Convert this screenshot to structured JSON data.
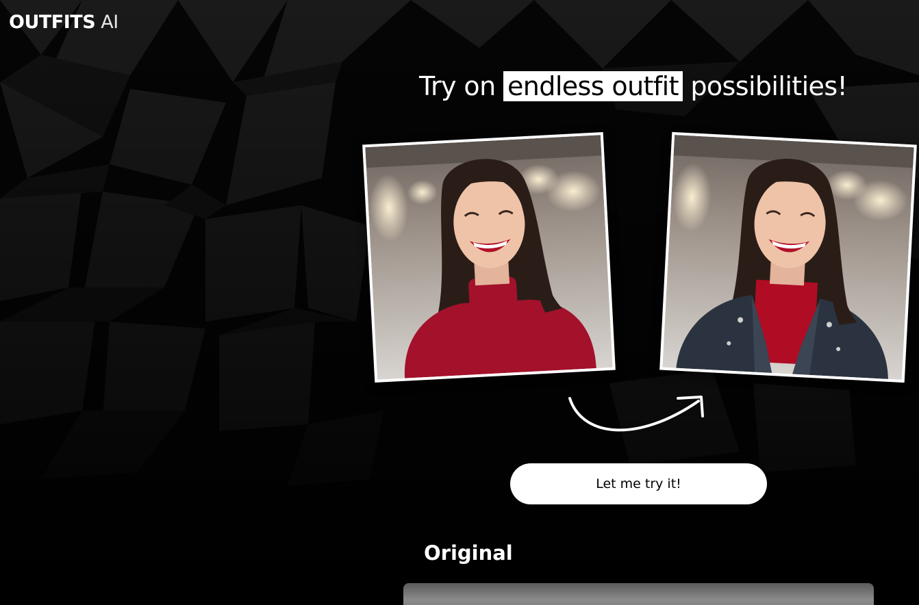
{
  "header": {
    "logo_strong": "OUTFITS",
    "logo_light": "AI"
  },
  "hero": {
    "headline_before": "Try on ",
    "headline_highlight": "endless outfit",
    "headline_after": " possibilities!",
    "cta_label": "Let me try it!"
  },
  "examples": {
    "before_desc": "woman-red-turtleneck-photo",
    "after_desc": "woman-leather-jacket-photo"
  },
  "section": {
    "title": "Original"
  },
  "colors": {
    "background": "#000000",
    "text": "#ffffff",
    "button_bg": "#ffffff",
    "button_text": "#000000",
    "sweater_red": "#a3112a"
  }
}
